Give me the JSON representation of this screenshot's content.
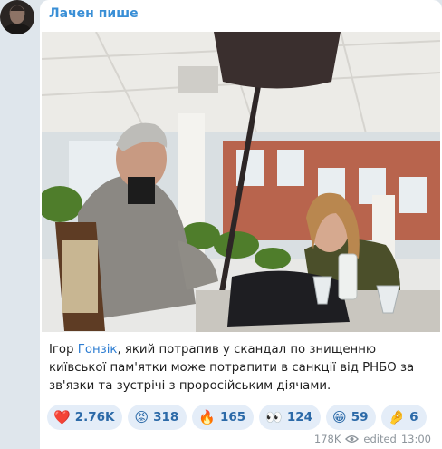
{
  "channel": {
    "name": "Лачен пише"
  },
  "post": {
    "caption_before": "Ігор ",
    "caption_highlight": "Гонзік",
    "caption_after": ", який потрапив у скандал по знищенню київської пам'ятки може потрапити в санкції від РНБО за зв'язки та зустрічі з проросійським діячами.",
    "reactions": [
      {
        "icon": "heart",
        "emoji": "❤️",
        "count": "2.76K"
      },
      {
        "icon": "angry-face",
        "emoji": "😡",
        "count": "318"
      },
      {
        "icon": "fire",
        "emoji": "🔥",
        "count": "165"
      },
      {
        "icon": "eyes",
        "emoji": "👀",
        "count": "124"
      },
      {
        "icon": "grin-face",
        "emoji": "😁",
        "count": "59"
      },
      {
        "icon": "hand",
        "emoji": "🤌",
        "count": "6"
      }
    ],
    "views": "178K",
    "edited_label": "edited",
    "time": "13:00"
  },
  "colors": {
    "accent": "#3a8fd6",
    "reaction_bg": "#e4edf8",
    "reaction_text": "#2c6aa8"
  }
}
